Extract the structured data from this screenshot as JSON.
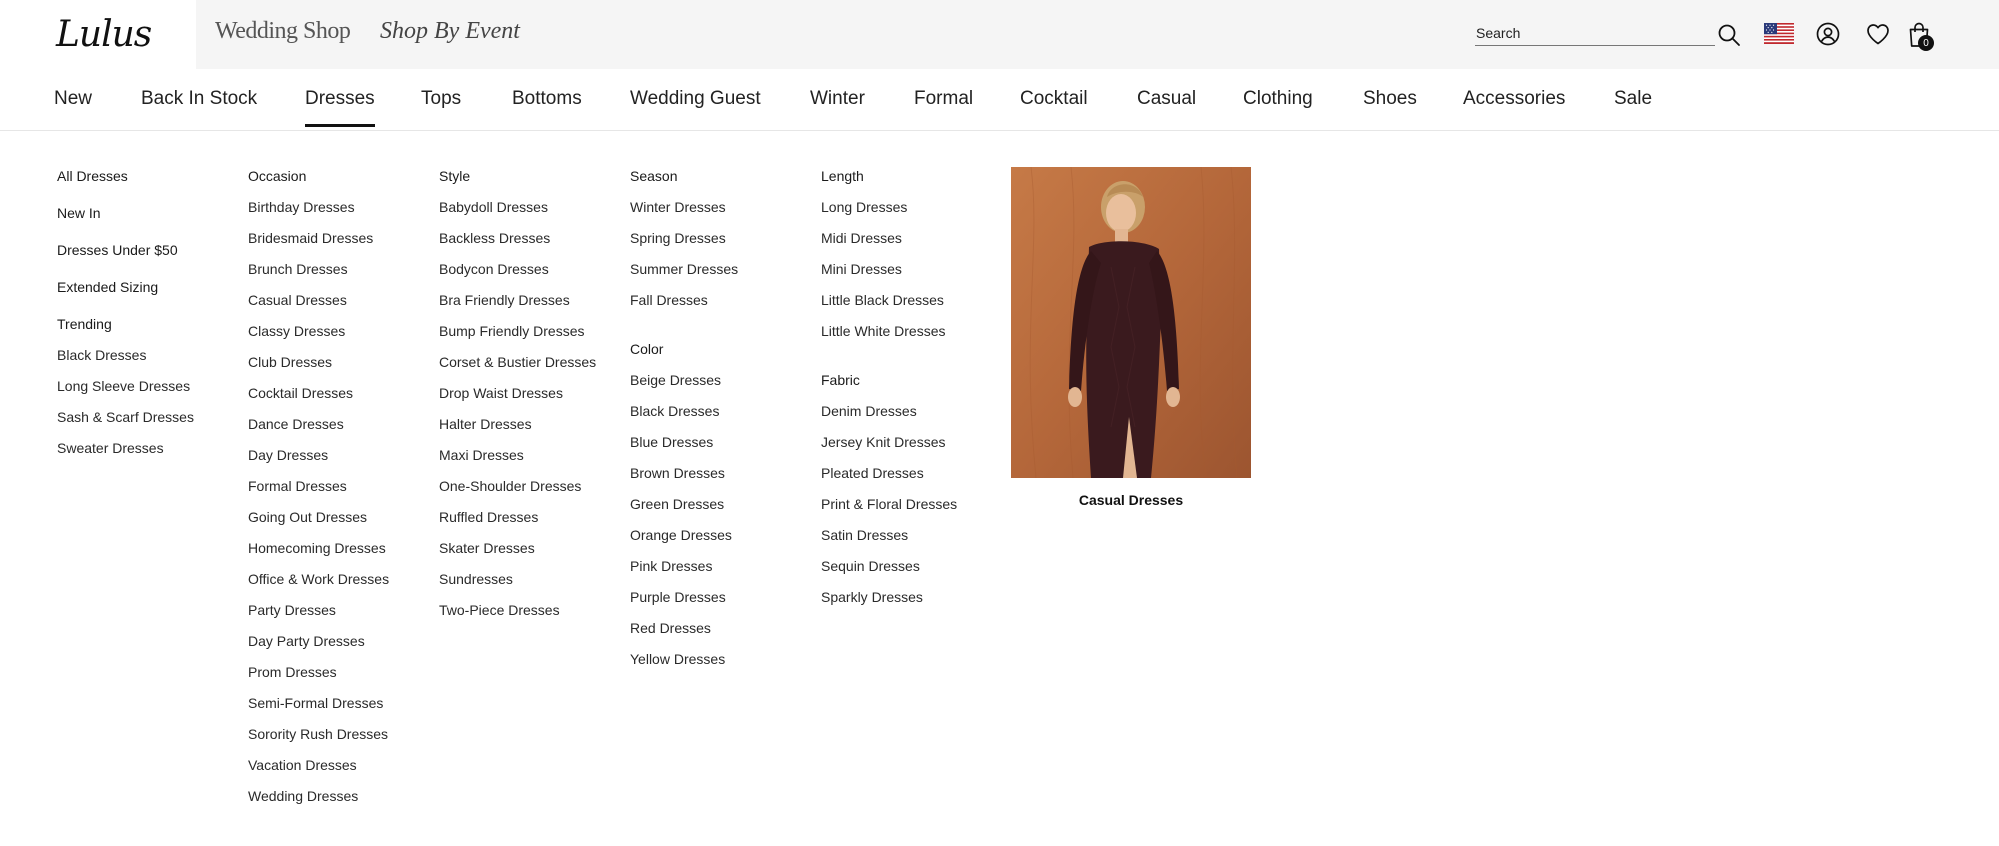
{
  "brand": {
    "logo_text": "Lulus"
  },
  "top_links": {
    "wedding_shop": "Wedding Shop",
    "shop_by_event": "Shop By Event"
  },
  "search": {
    "placeholder": "Search",
    "value": ""
  },
  "icons": {
    "search": "search-icon",
    "flag": "us-flag-icon",
    "account": "account-icon",
    "wishlist": "heart-icon",
    "bag": "shopping-bag-icon"
  },
  "bag": {
    "count": "0"
  },
  "nav": {
    "items": [
      "New",
      "Back In Stock",
      "Dresses",
      "Tops",
      "Bottoms",
      "Wedding Guest",
      "Winter",
      "Formal",
      "Cocktail",
      "Casual",
      "Clothing",
      "Shoes",
      "Accessories",
      "Sale"
    ],
    "active": "Dresses"
  },
  "menu": {
    "featured": [
      "All Dresses",
      "New In",
      "Dresses Under $50",
      "Extended Sizing"
    ],
    "trending": {
      "heading": "Trending",
      "items": [
        "Black Dresses",
        "Long Sleeve Dresses",
        "Sash & Scarf Dresses",
        "Sweater Dresses"
      ]
    },
    "occasion": {
      "heading": "Occasion",
      "items": [
        "Birthday Dresses",
        "Bridesmaid Dresses",
        "Brunch Dresses",
        "Casual Dresses",
        "Classy Dresses",
        "Club Dresses",
        "Cocktail Dresses",
        "Dance Dresses",
        "Day Dresses",
        "Formal Dresses",
        "Going Out Dresses",
        "Homecoming Dresses",
        "Office & Work Dresses",
        "Party Dresses",
        "Day Party Dresses",
        "Prom Dresses",
        "Semi-Formal Dresses",
        "Sorority Rush Dresses",
        "Vacation Dresses",
        "Wedding Dresses"
      ]
    },
    "style": {
      "heading": "Style",
      "items": [
        "Babydoll Dresses",
        "Backless Dresses",
        "Bodycon Dresses",
        "Bra Friendly Dresses",
        "Bump Friendly Dresses",
        "Corset & Bustier Dresses",
        "Drop Waist Dresses",
        "Halter Dresses",
        "Maxi Dresses",
        "One-Shoulder Dresses",
        "Ruffled Dresses",
        "Skater Dresses",
        "Sundresses",
        "Two-Piece Dresses"
      ]
    },
    "season": {
      "heading": "Season",
      "items": [
        "Winter Dresses",
        "Spring Dresses",
        "Summer Dresses",
        "Fall Dresses"
      ]
    },
    "color": {
      "heading": "Color",
      "items": [
        "Beige Dresses",
        "Black Dresses",
        "Blue Dresses",
        "Brown Dresses",
        "Green Dresses",
        "Orange Dresses",
        "Pink Dresses",
        "Purple Dresses",
        "Red Dresses",
        "Yellow Dresses"
      ]
    },
    "length": {
      "heading": "Length",
      "items": [
        "Long Dresses",
        "Midi Dresses",
        "Mini Dresses",
        "Little Black Dresses",
        "Little White Dresses"
      ]
    },
    "fabric": {
      "heading": "Fabric",
      "items": [
        "Denim Dresses",
        "Jersey Knit Dresses",
        "Pleated Dresses",
        "Print & Floral Dresses",
        "Satin Dresses",
        "Sequin Dresses",
        "Sparkly Dresses"
      ]
    }
  },
  "promo": {
    "caption": "Casual Dresses"
  },
  "colors": {
    "text": "#1a1a1a",
    "topbar_bg": "#f5f5f5",
    "accent": "#111111",
    "promo_bg": "#b86a3c",
    "dress": "#3a1a1e"
  }
}
